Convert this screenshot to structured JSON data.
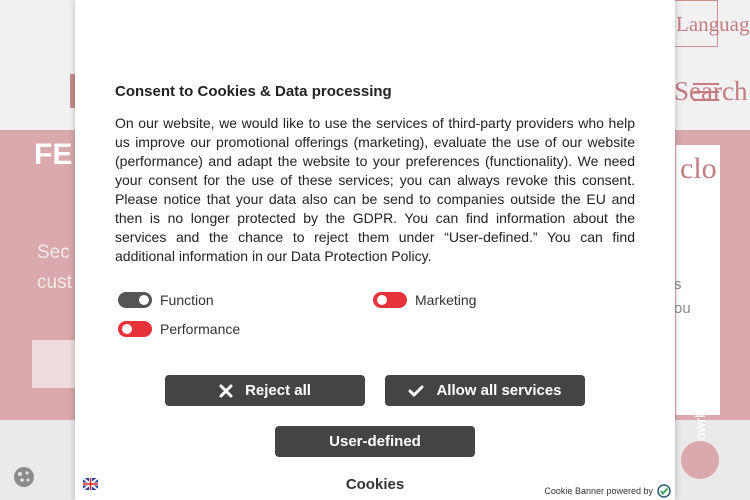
{
  "background": {
    "hero_title": "FE",
    "hero_text": "Sec cust",
    "language_label": "Language",
    "search_label": "Search",
    "side_heading": "clo",
    "side_line1": "s",
    "side_line2": "ou",
    "vertical_text": "owrh"
  },
  "modal": {
    "title": "Consent to Cookies & Data processing",
    "body": "On our website, we would like to use the services of third-party providers who help us improve our promotional offerings (marketing), evaluate the use of our website (performance) and adapt the website to your preferences (functionality). We need your consent for the use of these services; you can always revoke this consent. Please notice that your data also can be send to companies outside the EU and then is no longer protected by the GDPR. You can find information about the services and the chance to reject them under “User-defined.” You can find additional information in our Data Protection Policy.",
    "options": [
      {
        "label": "Function",
        "state": "on"
      },
      {
        "label": "Marketing",
        "state": "off"
      },
      {
        "label": "Performance",
        "state": "off"
      }
    ],
    "reject_label": "Reject all",
    "allow_label": "Allow all services",
    "userdefined_label": "User-defined",
    "footer_label": "Cookies",
    "powered_by": "Cookie Banner powered by"
  },
  "colors": {
    "button_bg": "#444444",
    "toggle_on": "#555555",
    "toggle_off": "#e8323a",
    "hero_bg": "#d9a9ab",
    "accent": "#c57b80"
  }
}
